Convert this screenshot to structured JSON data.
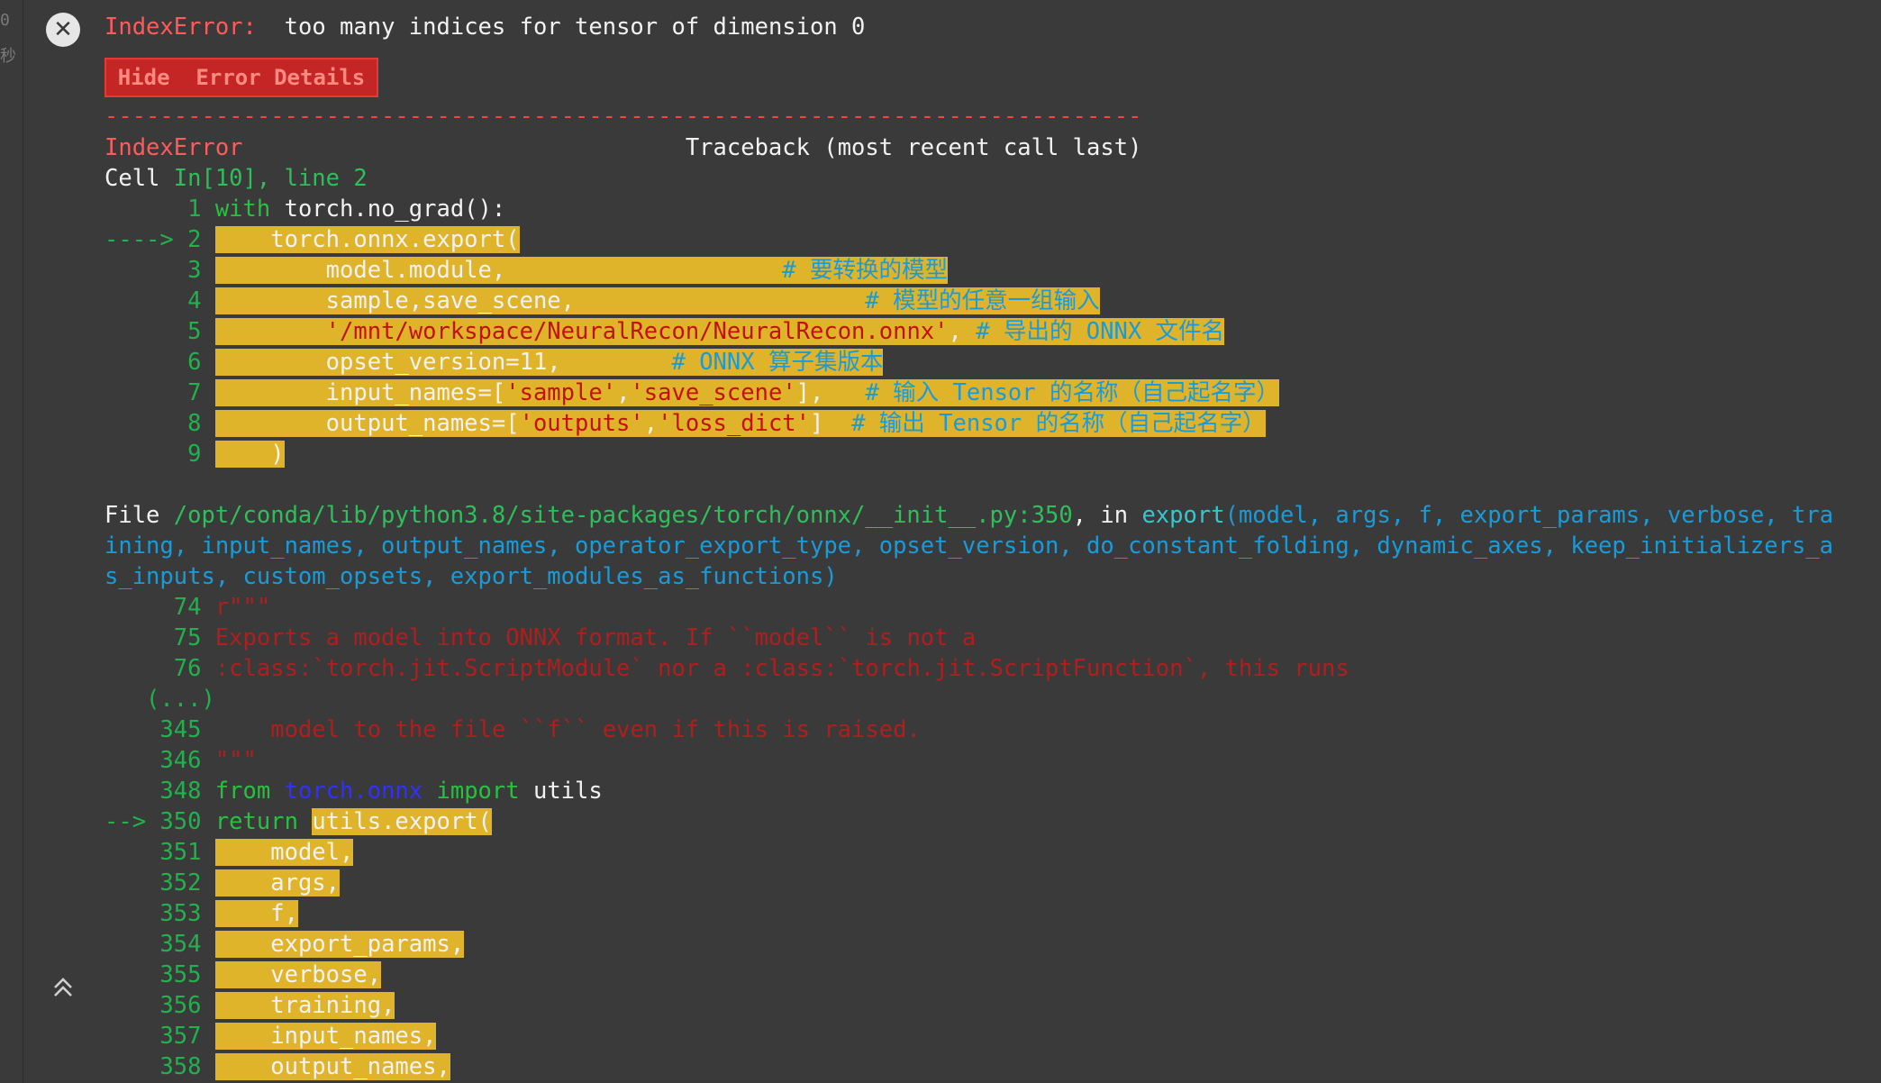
{
  "gutter": {
    "marks": [
      "0",
      "秒"
    ]
  },
  "error_header": {
    "name": "IndexError:",
    "message": "too many indices for tensor of dimension 0"
  },
  "toggle_button": {
    "label": "Hide  Error Details"
  },
  "separator": "---------------------------------------------------------------------------",
  "traceback_header": {
    "error": "IndexError",
    "label": "Traceback (most recent call last)"
  },
  "cell_ref": {
    "prefix": "Cell ",
    "location": "In[10], line 2"
  },
  "cell_frame": {
    "lines": [
      {
        "gutter": "      1 ",
        "kw": "with",
        "code": " torch.no_grad():"
      },
      {
        "gutter": "----> 2 ",
        "indent": "    ",
        "code": "torch.onnx.export("
      },
      {
        "gutter": "      3 ",
        "indent": "        ",
        "code": "model.module,",
        "pad": "                    ",
        "comment": "# 要转换的模型"
      },
      {
        "gutter": "      4 ",
        "indent": "        ",
        "code": "sample,save_scene,",
        "pad": "                     ",
        "comment": "# 模型的任意一组输入"
      },
      {
        "gutter": "      5 ",
        "indent": "        ",
        "str": "'/mnt/workspace/NeuralRecon/NeuralRecon.onnx'",
        "code": ", ",
        "comment": "# 导出的 ONNX 文件名"
      },
      {
        "gutter": "      6 ",
        "indent": "        ",
        "code": "opset_version=11,",
        "pad": "        ",
        "comment": "# ONNX 算子集版本"
      },
      {
        "gutter": "      7 ",
        "indent": "        ",
        "code": "input_names=[",
        "str": "'sample'",
        "code2": ",",
        "str2": "'save_scene'",
        "code3": "],",
        "pad": "   ",
        "comment": "# 输入 Tensor 的名称（自己起名字）"
      },
      {
        "gutter": "      8 ",
        "indent": "        ",
        "code": "output_names=[",
        "str": "'outputs'",
        "code2": ",",
        "str2": "'loss_dict'",
        "code3": "]",
        "pad": "  ",
        "comment": "# 输出 Tensor 的名称（自己起名字）"
      },
      {
        "gutter": "      9 ",
        "indent": "    ",
        "code": ")"
      }
    ]
  },
  "file_frame": {
    "prefix": "File ",
    "path": "/opt/conda/lib/python3.8/site-packages/torch/onnx/__init__.py:350",
    "middle": ", in ",
    "func": "export",
    "sig1": "(model, args, f, export_params, verbose, tra",
    "sig2": "ining, input_names, output_names, operator_export_type, opset_version, do_constant_folding, dynamic_axes, keep_initializers_a",
    "sig3": "s_inputs, custom_opsets, export_modules_as_functions)",
    "doc_lines": [
      {
        "gutter": "     74 ",
        "text": "r\"\"\""
      },
      {
        "gutter": "     75 ",
        "text": "Exports a model into ONNX format. If ``model`` is not a"
      },
      {
        "gutter": "     76 ",
        "text": ":class:`torch.jit.ScriptModule` nor a :class:`torch.jit.ScriptFunction`, this runs"
      }
    ],
    "ellipsis": "   (...)",
    "doc_lines2": [
      {
        "gutter": "    345 ",
        "text": "    model to the file ``f`` even if this is raised."
      },
      {
        "gutter": "    346 ",
        "text": "\"\"\""
      }
    ],
    "import_line": {
      "gutter": "    348 ",
      "kw1": "from",
      "mod": "torch.onnx",
      "kw2": "import",
      "name": " utils"
    },
    "return_line": {
      "gutter": "--> 350 ",
      "kw": "return",
      "code": "utils.export("
    },
    "args": [
      {
        "gutter": "    351 ",
        "text": "model,"
      },
      {
        "gutter": "    352 ",
        "text": "args,"
      },
      {
        "gutter": "    353 ",
        "text": "f,"
      },
      {
        "gutter": "    354 ",
        "text": "export_params,"
      },
      {
        "gutter": "    355 ",
        "text": "verbose,"
      },
      {
        "gutter": "    356 ",
        "text": "training,"
      },
      {
        "gutter": "    357 ",
        "text": "input_names,"
      },
      {
        "gutter": "    358 ",
        "text": "output_names,"
      }
    ]
  }
}
